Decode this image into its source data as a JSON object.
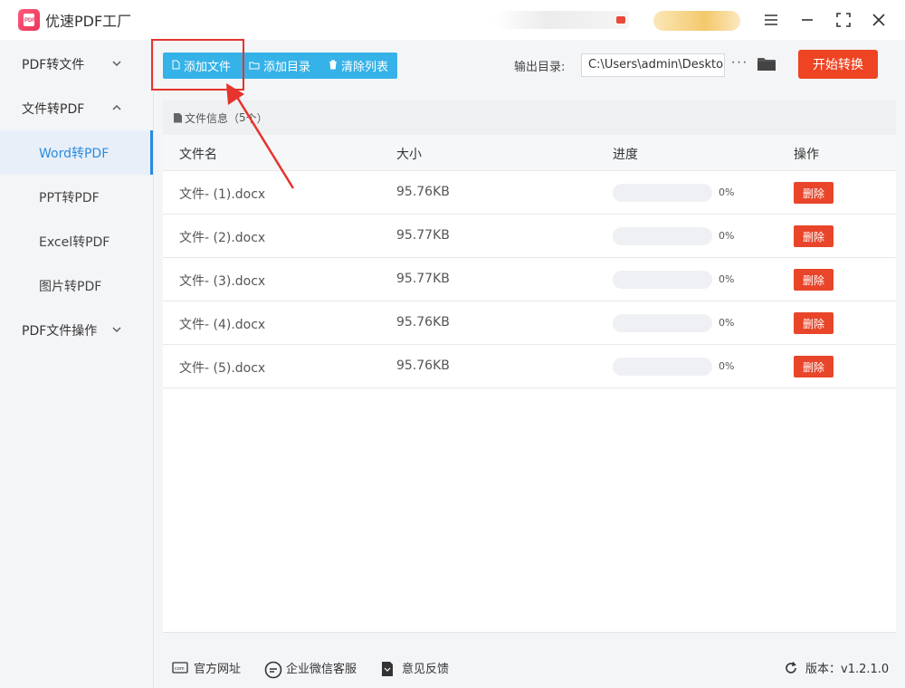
{
  "app": {
    "title": "优速PDF工厂",
    "logo_text": "PDF"
  },
  "window_controls": [
    "menu-icon",
    "minimize-icon",
    "maximize-icon",
    "close-icon"
  ],
  "sidebar": {
    "groups": [
      {
        "label": "PDF转文件",
        "expanded": false
      },
      {
        "label": "文件转PDF",
        "expanded": true,
        "items": [
          "Word转PDF",
          "PPT转PDF",
          "Excel转PDF",
          "图片转PDF"
        ],
        "active": "Word转PDF"
      },
      {
        "label": "PDF文件操作",
        "expanded": false
      }
    ]
  },
  "toolbar": {
    "add_file": "添加文件",
    "add_folder": "添加目录",
    "clear_list": "清除列表",
    "output_label": "输出目录:",
    "output_path": "C:\\Users\\admin\\Desktop",
    "more": "···",
    "start": "开始转换"
  },
  "panel": {
    "info_prefix": "文件信息（",
    "count": "5",
    "info_suffix": " 个）",
    "columns": {
      "name": "文件名",
      "size": "大小",
      "progress": "进度",
      "op": "操作"
    },
    "rows": [
      {
        "name": "文件- (1).docx",
        "size": "95.76KB",
        "progress": 0,
        "progress_text": "0%",
        "action": "删除"
      },
      {
        "name": "文件- (2).docx",
        "size": "95.77KB",
        "progress": 0,
        "progress_text": "0%",
        "action": "删除"
      },
      {
        "name": "文件- (3).docx",
        "size": "95.77KB",
        "progress": 0,
        "progress_text": "0%",
        "action": "删除"
      },
      {
        "name": "文件- (4).docx",
        "size": "95.76KB",
        "progress": 0,
        "progress_text": "0%",
        "action": "删除"
      },
      {
        "name": "文件- (5).docx",
        "size": "95.76KB",
        "progress": 0,
        "progress_text": "0%",
        "action": "删除"
      }
    ]
  },
  "footer": {
    "website": "官方网址",
    "wechat": "企业微信客服",
    "feedback": "意见反馈",
    "version": "版本：v1.2.1.0"
  },
  "colors": {
    "accent": "#35b2e8",
    "start": "#ee4423",
    "delete": "#e8452a",
    "annotation": "#e5332d"
  }
}
